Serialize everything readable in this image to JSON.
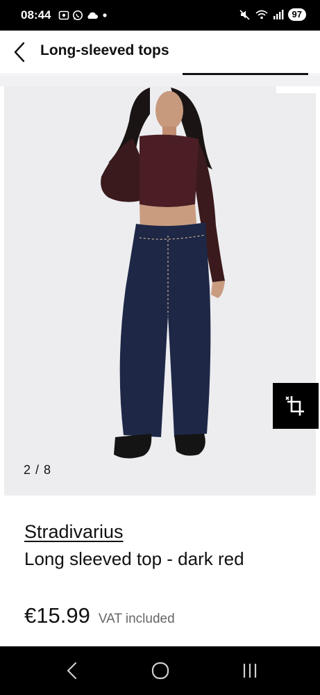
{
  "status_bar": {
    "time": "08:44",
    "battery": "97",
    "left_icons": [
      "screenshot-icon",
      "whatsapp-icon",
      "cloud-icon",
      "dot-icon"
    ],
    "right_icons": [
      "mute-icon",
      "wifi-icon",
      "signal-icon",
      "battery-icon"
    ]
  },
  "header": {
    "title": "Long-sleeved tops",
    "back_icon": "back-arrow-icon"
  },
  "gallery": {
    "counter": "2 / 8",
    "compare_icon": "compare-icon"
  },
  "product": {
    "brand": "Stradivarius",
    "name": "Long sleeved top - dark red",
    "price": "€15.99",
    "vat_note": "VAT included"
  },
  "nav": {
    "icons": [
      "nav-back-icon",
      "nav-home-icon",
      "nav-recents-icon"
    ]
  },
  "colors": {
    "accent": "#000000",
    "background": "#ffffff",
    "image_bg": "#ededf0"
  }
}
